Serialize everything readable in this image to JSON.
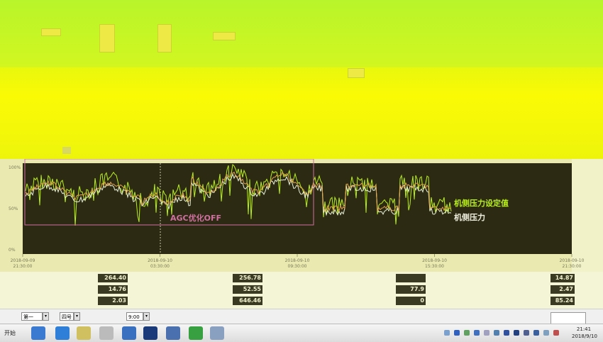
{
  "window": {
    "title": ""
  },
  "annotations": {
    "agc_off": "AGC优化OFF",
    "setpoint_label": "机侧压力设定值",
    "actual_label": "机侧压力"
  },
  "chart_data": {
    "type": "line",
    "ylabel": "",
    "y_ticks": [
      "100%",
      "50%",
      "0%"
    ],
    "x_ticks": [
      {
        "date": "2018-09-09",
        "time": "21:30:00"
      },
      {
        "date": "2018-09-10",
        "time": "03:30:00"
      },
      {
        "date": "2018-09-10",
        "time": "09:30:00"
      },
      {
        "date": "2018-09-10",
        "time": "15:30:00"
      },
      {
        "date": "2018-09-10",
        "time": "21:30:00"
      }
    ],
    "series": [
      {
        "name": "机侧压力设定值",
        "color": "#b8f01a"
      },
      {
        "name": "机侧压力",
        "color": "#e8f0d8"
      }
    ],
    "grid": false
  },
  "readings": [
    {
      "value": "264.40",
      "unit": ""
    },
    {
      "value": "14.76",
      "unit": ""
    },
    {
      "value": "2.03",
      "unit": ""
    },
    {
      "value": "256.78",
      "unit": ""
    },
    {
      "value": "52.55",
      "unit": ""
    },
    {
      "value": "646.46",
      "unit": ""
    },
    {
      "value": "",
      "unit": ""
    },
    {
      "value": "77.9",
      "unit": ""
    },
    {
      "value": "0",
      "unit": ""
    },
    {
      "value": "14.87",
      "unit": ""
    },
    {
      "value": "2.47",
      "unit": ""
    },
    {
      "value": "85.24",
      "unit": ""
    }
  ],
  "selectors": [
    {
      "value": "第一"
    },
    {
      "value": "四号"
    },
    {
      "value": "9:00"
    }
  ],
  "selector_labels": [
    "",
    "",
    ""
  ],
  "taskbar": {
    "start_label": "开始",
    "clock_time": "21:41",
    "clock_date": "2018/9/10"
  },
  "colors": {
    "setpoint": "#b8f01a",
    "actual": "#e8f0d8",
    "agc_box": "#d070a0",
    "plot_bg": "#2c2a12"
  }
}
